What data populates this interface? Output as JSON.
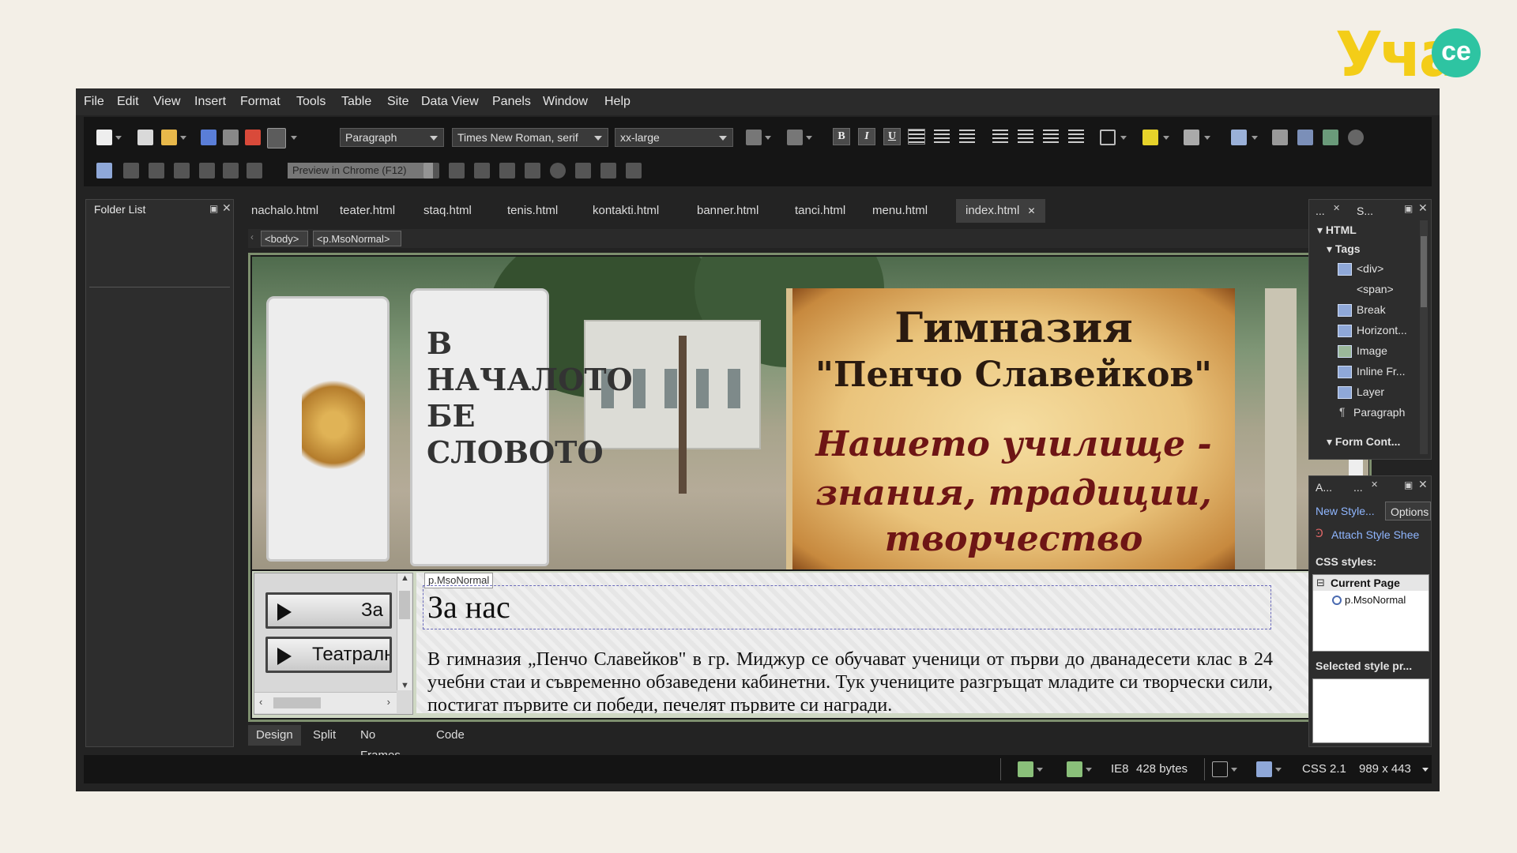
{
  "logo": {
    "text": "Учa",
    "bubble": "се"
  },
  "menu": [
    "File",
    "Edit",
    "View",
    "Insert",
    "Format",
    "Tools",
    "Table",
    "Site",
    "Data View",
    "Panels",
    "Window",
    "Help"
  ],
  "toolbar": {
    "paragraph_select": "Paragraph",
    "font_select": "Times New Roman, serif",
    "size_select": "xx-large",
    "bold": "B",
    "italic": "I",
    "underline": "U",
    "tooltip": "Preview in Chrome (F12)"
  },
  "folder_panel": {
    "title": "Folder List"
  },
  "tabs": [
    "nachalo.html",
    "teater.html",
    "staq.html",
    "tenis.html",
    "kontakti.html",
    "banner.html",
    "tanci.html",
    "menu.html",
    "index.html"
  ],
  "active_tab": "index.html",
  "breadcrumbs": [
    "<body>",
    "<p.MsoNormal>"
  ],
  "banner": {
    "sign_text": "В НАЧАЛОТО БЕ СЛОВОТО",
    "title_1": "Гимназия",
    "title_2": "\"Пенчо Славейков\"",
    "subtitle_1": "Нашето училище -",
    "subtitle_2": "знания, традиции,",
    "subtitle_3": "творчество"
  },
  "nav_buttons": [
    "За нас",
    "Театрални"
  ],
  "content": {
    "tag_label": "p.MsoNormal",
    "heading": "За нас",
    "paragraph": "В гимназия „Пенчо Славейков\" в гр. Миджур се обучават ученици от първи до дванадесети клас в 24 учебни стаи и съвременно обзаведени кабинетни. Тук учениците разгръщат младите си творчески сили, постигат първите си победи, печелят първите си награди."
  },
  "view_tabs": [
    "Design",
    "Split",
    "No Frames",
    "Code"
  ],
  "active_view": "Design",
  "toolbox": {
    "tab_1": "...",
    "tab_2": "S...",
    "section_html": "HTML",
    "section_tags": "Tags",
    "items": [
      "<div>",
      "<span>",
      "Break",
      "Horizont...",
      "Image",
      "Inline Fr...",
      "Layer",
      "Paragraph"
    ],
    "section_form": "Form Cont..."
  },
  "styles_panel": {
    "tab_1": "A...",
    "tab_2": "...",
    "new_style": "New Style...",
    "options": "Options",
    "attach": "Attach Style Shee",
    "css_styles": "CSS styles:",
    "current_page": "Current Page",
    "style_item": "p.MsoNormal",
    "selected_style": "Selected style pr..."
  },
  "status": {
    "browser": "IE8",
    "size": "428 bytes",
    "css": "CSS 2.1",
    "dimensions": "989 x 443"
  },
  "colors": {
    "accent_border": "#7d8f6e",
    "link": "#8fb6ff",
    "logo_yellow": "#f3cd18",
    "logo_teal": "#2ec4a2"
  }
}
